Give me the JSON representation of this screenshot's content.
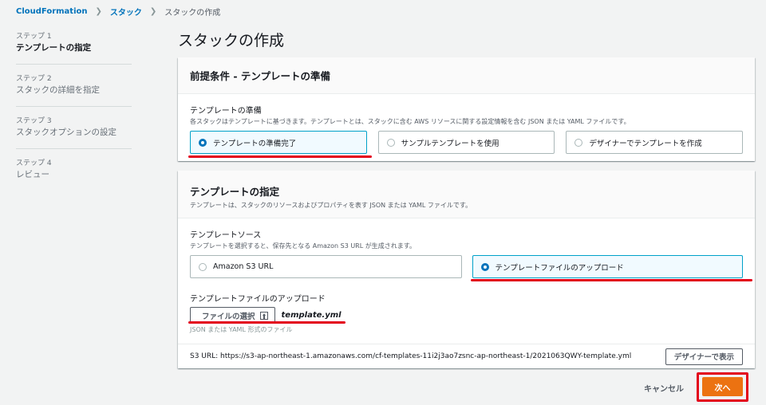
{
  "breadcrumb": {
    "items": [
      "CloudFormation",
      "スタック"
    ],
    "current": "スタックの作成"
  },
  "sidebar": {
    "steps": [
      {
        "num": "ステップ 1",
        "label": "テンプレートの指定",
        "active": true
      },
      {
        "num": "ステップ 2",
        "label": "スタックの詳細を指定",
        "active": false
      },
      {
        "num": "ステップ 3",
        "label": "スタックオプションの設定",
        "active": false
      },
      {
        "num": "ステップ 4",
        "label": "レビュー",
        "active": false
      }
    ]
  },
  "page_title": "スタックの作成",
  "prereq": {
    "header": "前提条件 - テンプレートの準備",
    "field_label": "テンプレートの準備",
    "field_desc": "各スタックはテンプレートに基づきます。テンプレートとは、スタックに含む AWS リソースに関する設定情報を含む JSON または YAML ファイルです。",
    "options": [
      "テンプレートの準備完了",
      "サンプルテンプレートを使用",
      "デザイナーでテンプレートを作成"
    ],
    "selected": "テンプレートの準備完了"
  },
  "spec": {
    "header": "テンプレートの指定",
    "header_desc": "テンプレートは、スタックのリソースおよびプロパティを表す JSON または YAML ファイルです。",
    "source_label": "テンプレートソース",
    "source_desc": "テンプレートを選択すると、保存先となる Amazon S3 URL が生成されます。",
    "source_options": [
      "Amazon S3 URL",
      "テンプレートファイルのアップロード"
    ],
    "source_selected": "テンプレートファイルのアップロード",
    "upload_label": "テンプレートファイルのアップロード",
    "choose_file_label": "ファイルの選択",
    "file_name": "template.yml",
    "file_hint": "JSON または YAML 形式のファイル",
    "s3_url_text": "S3 URL:  https://s3-ap-northeast-1.amazonaws.com/cf-templates-11i2j3ao7zsnc-ap-northeast-1/2021063QWY-template.yml",
    "view_designer_label": "デザイナーで表示"
  },
  "footer": {
    "cancel_label": "キャンセル",
    "next_label": "次へ"
  },
  "colors": {
    "link": "#0073bb",
    "primary": "#ec7211",
    "selected_border": "#00a1c9",
    "annotation_red": "#e3001b"
  }
}
